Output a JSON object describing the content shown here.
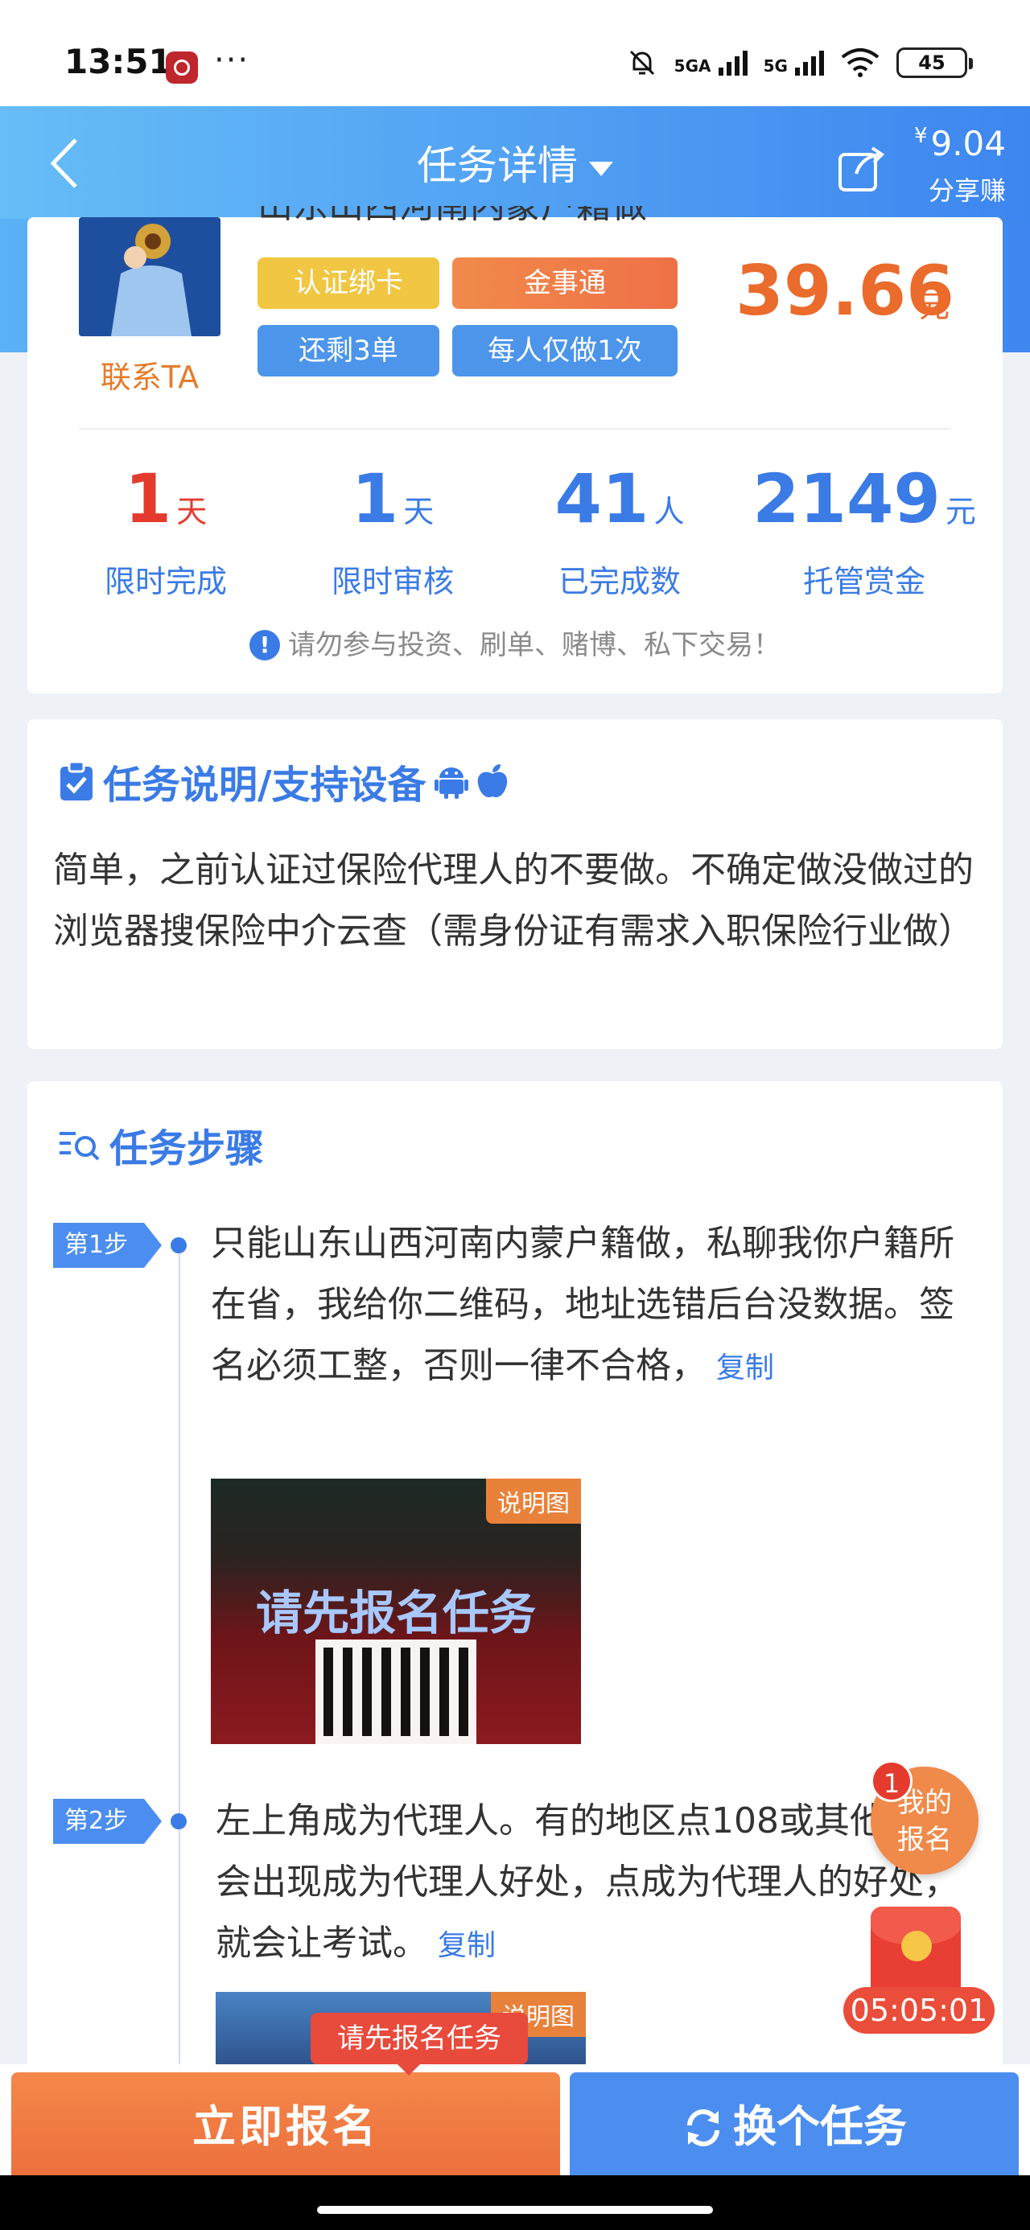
{
  "status_bar": {
    "time": "13:51",
    "dots": "···",
    "net1": "5GA",
    "net2": "5G",
    "battery": "45"
  },
  "header": {
    "title": "任务详情",
    "share_currency": "¥",
    "share_amount": "9.04",
    "share_label": "分享赚"
  },
  "task": {
    "title_partial": "山东山西河南内蒙户籍做",
    "contact": "联系TA",
    "tags": [
      "认证绑卡",
      "金事通",
      "还剩3单",
      "每人仅做1次"
    ],
    "price": "39.66",
    "price_unit": "元",
    "stats": [
      {
        "num": "1",
        "unit": "天",
        "label": "限时完成"
      },
      {
        "num": "1",
        "unit": "天",
        "label": "限时审核"
      },
      {
        "num": "41",
        "unit": "人",
        "label": "已完成数"
      },
      {
        "num": "2149",
        "unit": "元",
        "label": "托管赏金"
      }
    ],
    "warning": "请勿参与投资、刷单、赌博、私下交易！"
  },
  "description": {
    "title": "任务说明/支持设备",
    "text": "简单，之前认证过保险代理人的不要做。不确定做没做过的浏览器搜保险中介云查（需身份证有需求入职保险行业做）"
  },
  "steps": {
    "title": "任务步骤",
    "items": [
      {
        "badge": "第1步",
        "text": "只能山东山西河南内蒙户籍做，私聊我你户籍所在省，我给你二维码，地址选错后台没数据。签名必须工整，否则一律不合格，",
        "copy": "复制",
        "image_label": "说明图",
        "image_overlay": "请先报名任务"
      },
      {
        "badge": "第2步",
        "text": "左上角成为代理人。有的地区点108或其他数字会出现成为代理人好处，点成为代理人的好处，就会让考试。",
        "copy": "复制",
        "image_label": "说明图"
      }
    ]
  },
  "floating": {
    "badge_count": "1",
    "signup_label": "我的报名",
    "timer": "05:05:01"
  },
  "bottom": {
    "tooltip": "请先报名任务",
    "primary": "立即报名",
    "secondary": "换个任务"
  },
  "colors": {
    "brand_blue": "#3a7be6",
    "orange": "#ea6b2b",
    "red": "#e43b2e"
  }
}
